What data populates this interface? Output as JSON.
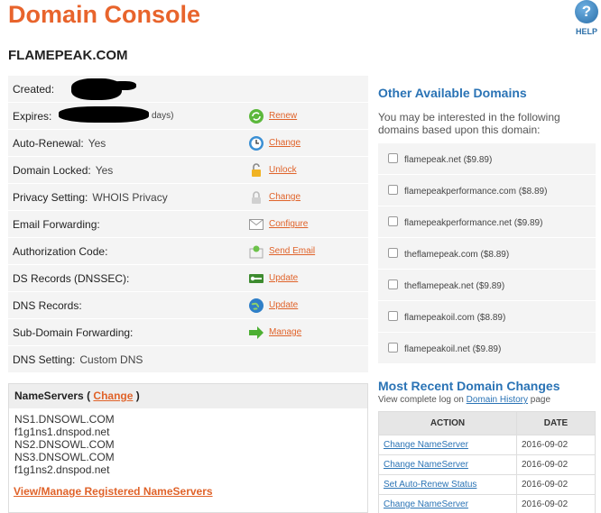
{
  "header": {
    "title": "Domain Console",
    "help_label": "HELP",
    "help_glyph": "?"
  },
  "domain": {
    "name": "FLAMEPEAK.COM"
  },
  "settings": {
    "created_label": "Created:",
    "expires_label": "Expires:",
    "expires_suffix": "days)",
    "renew": "Renew",
    "auto_renewal_label": "Auto-Renewal:",
    "auto_renewal_value": "Yes",
    "auto_renewal_action": "Change",
    "locked_label": "Domain Locked:",
    "locked_value": "Yes",
    "locked_action": "Unlock",
    "privacy_label": "Privacy Setting:",
    "privacy_value": "WHOIS Privacy",
    "privacy_action": "Change",
    "email_label": "Email Forwarding:",
    "email_action": "Configure",
    "auth_label": "Authorization Code:",
    "auth_action": "Send Email",
    "ds_label": "DS Records (DNSSEC):",
    "ds_action": "Update",
    "dns_records_label": "DNS Records:",
    "dns_records_action": "Update",
    "subdomain_label": "Sub-Domain Forwarding:",
    "subdomain_action": "Manage",
    "dns_setting_label": "DNS Setting:",
    "dns_setting_value": "Custom DNS"
  },
  "nameservers": {
    "title": "NameServers",
    "open": "(",
    "change": "Change",
    "close": ")",
    "list": [
      "NS1.DNSOWL.COM",
      "f1g1ns1.dnspod.net",
      "NS2.DNSOWL.COM",
      "NS3.DNSOWL.COM",
      "f1g1ns2.dnspod.net"
    ],
    "manage_link": "View/Manage Registered NameServers"
  },
  "other_domains": {
    "title": "Other Available Domains",
    "intro": "You may be interested in the following domains based upon this domain:",
    "items": [
      "flamepeak.net ($9.89)",
      "flamepeakperformance.com ($8.89)",
      "flamepeakperformance.net ($9.89)",
      "theflamepeak.com ($8.89)",
      "theflamepeak.net ($9.89)",
      "flamepeakoil.com ($8.89)",
      "flamepeakoil.net ($9.89)"
    ]
  },
  "changes": {
    "title": "Most Recent Domain Changes",
    "sub_prefix": "View complete log on",
    "sub_link": "Domain History",
    "sub_suffix": "page",
    "col_action": "ACTION",
    "col_date": "DATE",
    "rows": [
      {
        "action": "Change NameServer",
        "date": "2016-09-02"
      },
      {
        "action": "Change NameServer",
        "date": "2016-09-02"
      },
      {
        "action": "Set Auto-Renew Status",
        "date": "2016-09-02"
      },
      {
        "action": "Change NameServer",
        "date": "2016-09-02"
      }
    ]
  },
  "colors": {
    "brand_orange": "#e8642c",
    "link_blue": "#2a73b5",
    "row_bg": "#f4f4f4"
  },
  "icons": [
    "renew-icon",
    "clock-icon",
    "unlock-icon",
    "lock-icon",
    "envelope-icon",
    "send-email-icon",
    "key-icon",
    "globe-icon",
    "arrow-right-icon",
    "help-icon"
  ]
}
